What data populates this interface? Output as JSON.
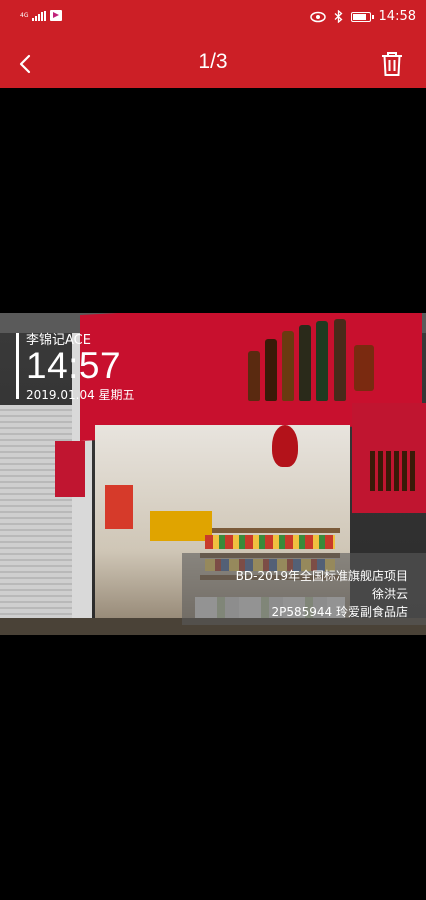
{
  "status_bar": {
    "network": "4G",
    "time": "14:58"
  },
  "toolbar": {
    "page_counter": "1/3"
  },
  "photo": {
    "watermark": {
      "brand": "李锦记ACE",
      "time": "14:57",
      "date": "2019.01.04 星期五"
    },
    "info_lines": [
      "BD-2019年全国标准旗舰店项目",
      "徐洪云",
      "2P585944 玲爱副食品店"
    ]
  },
  "colors": {
    "header_bg": "#cc1f26",
    "background": "#000000"
  }
}
